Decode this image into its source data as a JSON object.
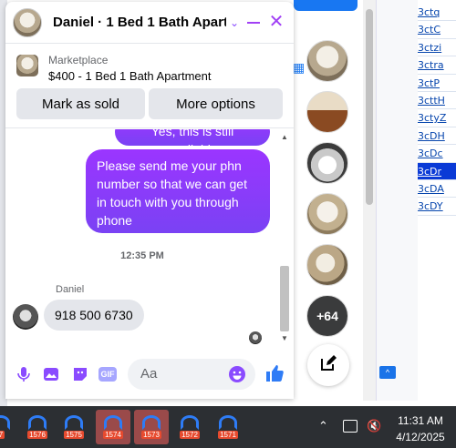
{
  "background": {
    "links": [
      "3ctq",
      "3ctC",
      "3ctzi",
      "3ctra",
      "3ctP",
      "3cttH",
      "3ctyZ",
      "3cDH",
      "3cDc",
      "3cDr",
      "3cDA",
      "3cDY"
    ],
    "highlighted_link_index": 9
  },
  "chat": {
    "title": "Daniel · 1 Bed 1 Bath Apart…",
    "listing": {
      "source": "Marketplace",
      "title": "$400 - 1 Bed 1 Bath Apartment",
      "mark_sold_label": "Mark as sold",
      "more_options_label": "More options"
    },
    "messages": {
      "partial_outgoing": "Yes, this is still available",
      "outgoing": "Please send me your phn number so that we can get in touch with you through phone",
      "timestamp": "12:35 PM",
      "sender_name": "Daniel",
      "incoming": "918 500 6730"
    },
    "composer": {
      "placeholder": "Aa",
      "gif_label": "GIF"
    }
  },
  "chat_heads": {
    "more_count": "+64"
  },
  "taskbar": {
    "items": [
      {
        "label": "7",
        "active": false
      },
      {
        "label": "1576",
        "active": false
      },
      {
        "label": "1575",
        "active": false
      },
      {
        "label": "1574",
        "active": true
      },
      {
        "label": "1573",
        "active": true
      },
      {
        "label": "1572",
        "active": false
      },
      {
        "label": "1571",
        "active": false
      }
    ],
    "time": "11:31 AM",
    "date": "4/12/2025"
  },
  "colors": {
    "accent_purple": "#a140f5",
    "bubble_gradient_top": "#9b35ff",
    "bubble_gradient_bottom": "#7a42f4",
    "link_blue": "#0645ad",
    "taskbar": "#2c2f33"
  }
}
